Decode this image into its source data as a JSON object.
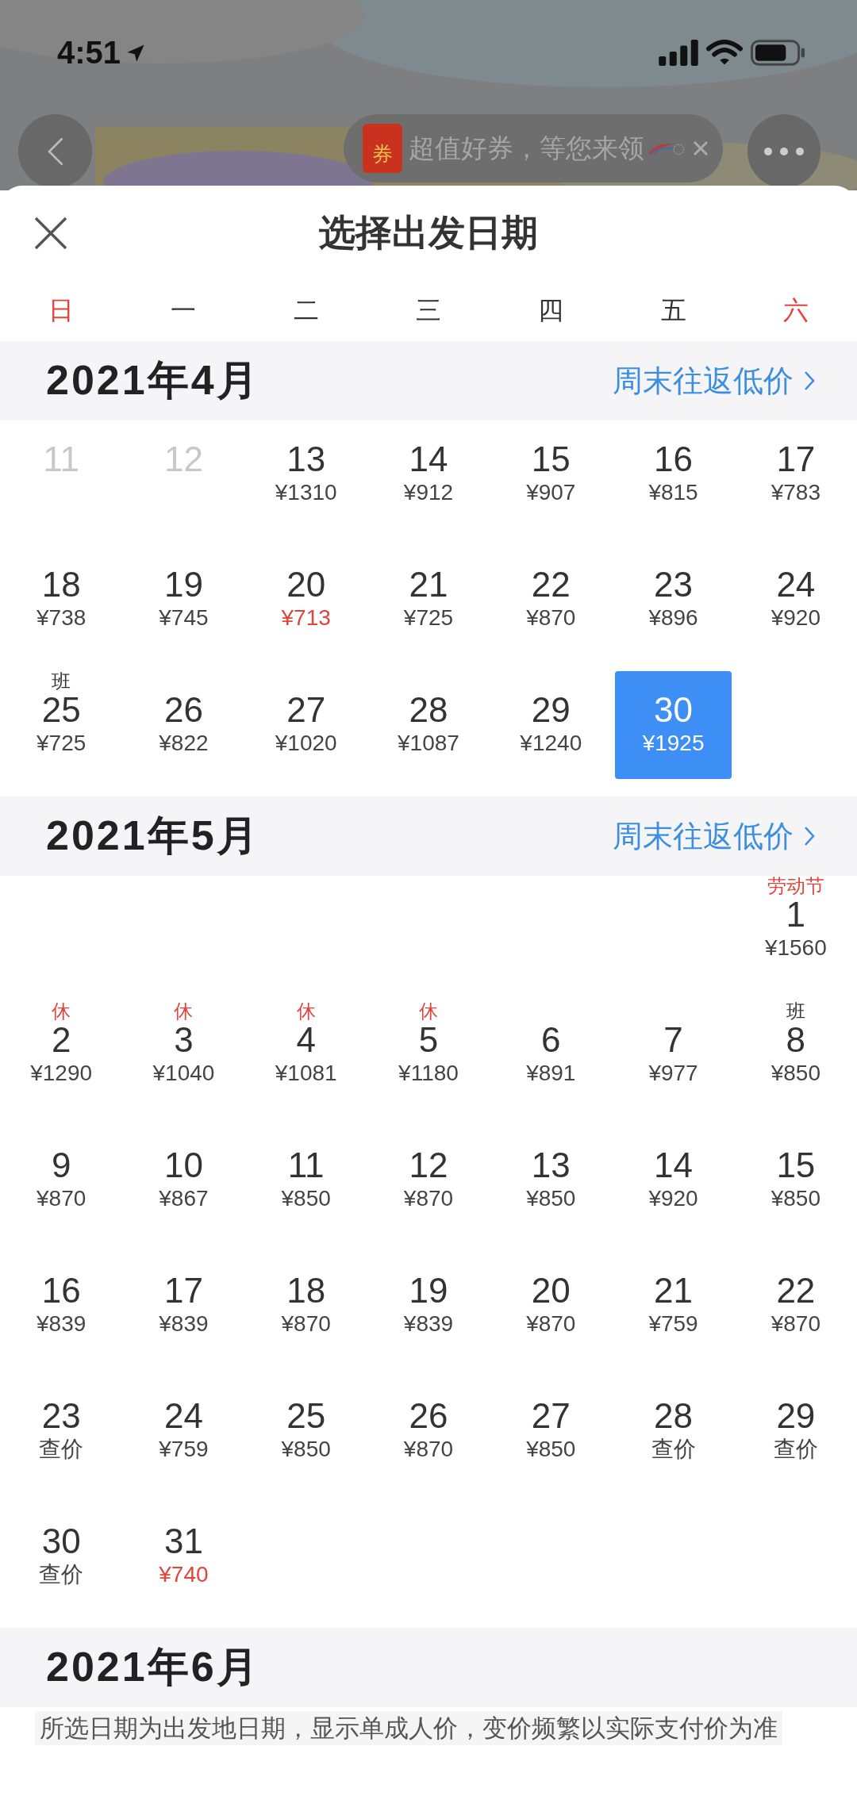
{
  "status_bar": {
    "time": "4:51"
  },
  "promo_pill": {
    "badge": "券",
    "text": "超值好券，等您来领"
  },
  "sheet": {
    "title": "选择出发日期"
  },
  "weekdays": [
    {
      "label": "日",
      "weekend": true
    },
    {
      "label": "一",
      "weekend": false
    },
    {
      "label": "二",
      "weekend": false
    },
    {
      "label": "三",
      "weekend": false
    },
    {
      "label": "四",
      "weekend": false
    },
    {
      "label": "五",
      "weekend": false
    },
    {
      "label": "六",
      "weekend": true
    }
  ],
  "months": [
    {
      "title": "2021年4月",
      "link": "周末往返低价",
      "weeks": [
        [
          {
            "kind": "day",
            "day": "11",
            "disabled": true,
            "selected": false
          },
          {
            "kind": "day",
            "day": "12",
            "disabled": true,
            "selected": false
          },
          {
            "kind": "day",
            "day": "13",
            "price": {
              "text": "¥1310",
              "color": "#444444"
            },
            "disabled": false,
            "selected": false
          },
          {
            "kind": "day",
            "day": "14",
            "price": {
              "text": "¥912",
              "color": "#444444"
            },
            "disabled": false,
            "selected": false
          },
          {
            "kind": "day",
            "day": "15",
            "price": {
              "text": "¥907",
              "color": "#444444"
            },
            "disabled": false,
            "selected": false
          },
          {
            "kind": "day",
            "day": "16",
            "price": {
              "text": "¥815",
              "color": "#444444"
            },
            "disabled": false,
            "selected": false
          },
          {
            "kind": "day",
            "day": "17",
            "price": {
              "text": "¥783",
              "color": "#444444"
            },
            "disabled": false,
            "selected": false
          }
        ],
        [
          {
            "kind": "day",
            "day": "18",
            "price": {
              "text": "¥738",
              "color": "#444444"
            },
            "disabled": false,
            "selected": false
          },
          {
            "kind": "day",
            "day": "19",
            "price": {
              "text": "¥745",
              "color": "#444444"
            },
            "disabled": false,
            "selected": false
          },
          {
            "kind": "day",
            "day": "20",
            "price": {
              "text": "¥713",
              "color": "#e0443a"
            },
            "disabled": false,
            "selected": false
          },
          {
            "kind": "day",
            "day": "21",
            "price": {
              "text": "¥725",
              "color": "#444444"
            },
            "disabled": false,
            "selected": false
          },
          {
            "kind": "day",
            "day": "22",
            "price": {
              "text": "¥870",
              "color": "#444444"
            },
            "disabled": false,
            "selected": false
          },
          {
            "kind": "day",
            "day": "23",
            "price": {
              "text": "¥896",
              "color": "#444444"
            },
            "disabled": false,
            "selected": false
          },
          {
            "kind": "day",
            "day": "24",
            "price": {
              "text": "¥920",
              "color": "#444444"
            },
            "disabled": false,
            "selected": false
          }
        ],
        [
          {
            "kind": "day",
            "day": "25",
            "price": {
              "text": "¥725",
              "color": "#444444"
            },
            "tag": {
              "text": "班",
              "color": "#333333"
            },
            "disabled": false,
            "selected": false
          },
          {
            "kind": "day",
            "day": "26",
            "price": {
              "text": "¥822",
              "color": "#444444"
            },
            "disabled": false,
            "selected": false
          },
          {
            "kind": "day",
            "day": "27",
            "price": {
              "text": "¥1020",
              "color": "#444444"
            },
            "disabled": false,
            "selected": false
          },
          {
            "kind": "day",
            "day": "28",
            "price": {
              "text": "¥1087",
              "color": "#444444"
            },
            "disabled": false,
            "selected": false
          },
          {
            "kind": "day",
            "day": "29",
            "price": {
              "text": "¥1240",
              "color": "#444444"
            },
            "disabled": false,
            "selected": false
          },
          {
            "kind": "day",
            "day": "30",
            "price": {
              "text": "¥1925",
              "color": "#ffffff"
            },
            "disabled": false,
            "selected": true
          }
        ]
      ]
    },
    {
      "title": "2021年5月",
      "link": "周末往返低价",
      "weeks": [
        [
          {
            "kind": "blank"
          },
          {
            "kind": "blank"
          },
          {
            "kind": "blank"
          },
          {
            "kind": "blank"
          },
          {
            "kind": "blank"
          },
          {
            "kind": "blank"
          },
          {
            "kind": "day",
            "day": "1",
            "price": {
              "text": "¥1560",
              "color": "#444444"
            },
            "tag": {
              "text": "劳动节",
              "color": "#e0443a"
            },
            "disabled": false,
            "selected": false
          }
        ],
        [
          {
            "kind": "day",
            "day": "2",
            "price": {
              "text": "¥1290",
              "color": "#444444"
            },
            "tag": {
              "text": "休",
              "color": "#e0443a"
            },
            "disabled": false,
            "selected": false
          },
          {
            "kind": "day",
            "day": "3",
            "price": {
              "text": "¥1040",
              "color": "#444444"
            },
            "tag": {
              "text": "休",
              "color": "#e0443a"
            },
            "disabled": false,
            "selected": false
          },
          {
            "kind": "day",
            "day": "4",
            "price": {
              "text": "¥1081",
              "color": "#444444"
            },
            "tag": {
              "text": "休",
              "color": "#e0443a"
            },
            "disabled": false,
            "selected": false
          },
          {
            "kind": "day",
            "day": "5",
            "price": {
              "text": "¥1180",
              "color": "#444444"
            },
            "tag": {
              "text": "休",
              "color": "#e0443a"
            },
            "disabled": false,
            "selected": false
          },
          {
            "kind": "day",
            "day": "6",
            "price": {
              "text": "¥891",
              "color": "#444444"
            },
            "disabled": false,
            "selected": false
          },
          {
            "kind": "day",
            "day": "7",
            "price": {
              "text": "¥977",
              "color": "#444444"
            },
            "disabled": false,
            "selected": false
          },
          {
            "kind": "day",
            "day": "8",
            "price": {
              "text": "¥850",
              "color": "#444444"
            },
            "tag": {
              "text": "班",
              "color": "#333333"
            },
            "disabled": false,
            "selected": false
          }
        ],
        [
          {
            "kind": "day",
            "day": "9",
            "price": {
              "text": "¥870",
              "color": "#444444"
            },
            "disabled": false,
            "selected": false
          },
          {
            "kind": "day",
            "day": "10",
            "price": {
              "text": "¥867",
              "color": "#444444"
            },
            "disabled": false,
            "selected": false
          },
          {
            "kind": "day",
            "day": "11",
            "price": {
              "text": "¥850",
              "color": "#444444"
            },
            "disabled": false,
            "selected": false
          },
          {
            "kind": "day",
            "day": "12",
            "price": {
              "text": "¥870",
              "color": "#444444"
            },
            "disabled": false,
            "selected": false
          },
          {
            "kind": "day",
            "day": "13",
            "price": {
              "text": "¥850",
              "color": "#444444"
            },
            "disabled": false,
            "selected": false
          },
          {
            "kind": "day",
            "day": "14",
            "price": {
              "text": "¥920",
              "color": "#444444"
            },
            "disabled": false,
            "selected": false
          },
          {
            "kind": "day",
            "day": "15",
            "price": {
              "text": "¥850",
              "color": "#444444"
            },
            "disabled": false,
            "selected": false
          }
        ],
        [
          {
            "kind": "day",
            "day": "16",
            "price": {
              "text": "¥839",
              "color": "#444444"
            },
            "disabled": false,
            "selected": false
          },
          {
            "kind": "day",
            "day": "17",
            "price": {
              "text": "¥839",
              "color": "#444444"
            },
            "disabled": false,
            "selected": false
          },
          {
            "kind": "day",
            "day": "18",
            "price": {
              "text": "¥870",
              "color": "#444444"
            },
            "disabled": false,
            "selected": false
          },
          {
            "kind": "day",
            "day": "19",
            "price": {
              "text": "¥839",
              "color": "#444444"
            },
            "disabled": false,
            "selected": false
          },
          {
            "kind": "day",
            "day": "20",
            "price": {
              "text": "¥870",
              "color": "#444444"
            },
            "disabled": false,
            "selected": false
          },
          {
            "kind": "day",
            "day": "21",
            "price": {
              "text": "¥759",
              "color": "#444444"
            },
            "disabled": false,
            "selected": false
          },
          {
            "kind": "day",
            "day": "22",
            "price": {
              "text": "¥870",
              "color": "#444444"
            },
            "disabled": false,
            "selected": false
          }
        ],
        [
          {
            "kind": "day",
            "day": "23",
            "price": {
              "text": "查价",
              "color": "#444444"
            },
            "disabled": false,
            "selected": false
          },
          {
            "kind": "day",
            "day": "24",
            "price": {
              "text": "¥759",
              "color": "#444444"
            },
            "disabled": false,
            "selected": false
          },
          {
            "kind": "day",
            "day": "25",
            "price": {
              "text": "¥850",
              "color": "#444444"
            },
            "disabled": false,
            "selected": false
          },
          {
            "kind": "day",
            "day": "26",
            "price": {
              "text": "¥870",
              "color": "#444444"
            },
            "disabled": false,
            "selected": false
          },
          {
            "kind": "day",
            "day": "27",
            "price": {
              "text": "¥850",
              "color": "#444444"
            },
            "disabled": false,
            "selected": false
          },
          {
            "kind": "day",
            "day": "28",
            "price": {
              "text": "查价",
              "color": "#444444"
            },
            "disabled": false,
            "selected": false
          },
          {
            "kind": "day",
            "day": "29",
            "price": {
              "text": "查价",
              "color": "#444444"
            },
            "disabled": false,
            "selected": false
          }
        ],
        [
          {
            "kind": "day",
            "day": "30",
            "price": {
              "text": "查价",
              "color": "#444444"
            },
            "disabled": false,
            "selected": false
          },
          {
            "kind": "day",
            "day": "31",
            "price": {
              "text": "¥740",
              "color": "#e0443a"
            },
            "disabled": false,
            "selected": false
          }
        ]
      ]
    },
    {
      "title": "2021年6月"
    }
  ],
  "note": "所选日期为出发地日期，显示单成人价，变价频繁以实际支付价为准"
}
